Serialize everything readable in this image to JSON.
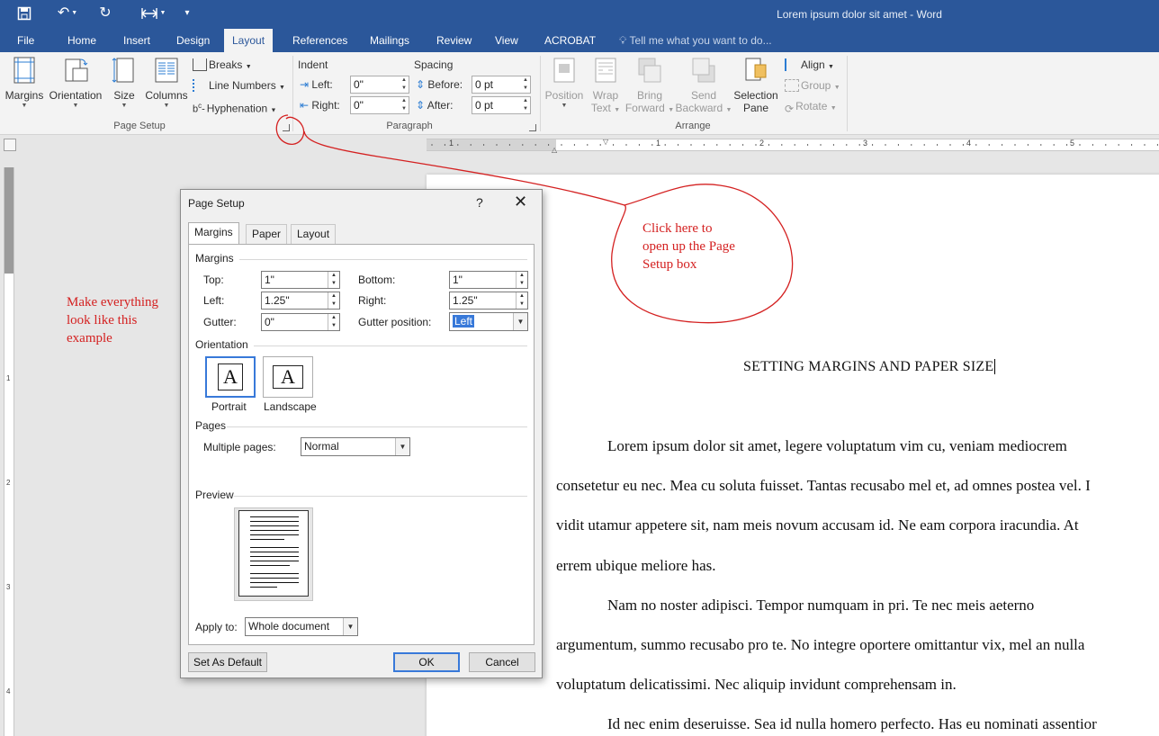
{
  "window": {
    "title": "Lorem ipsum dolor sit amet - Word"
  },
  "tabs": [
    "File",
    "Home",
    "Insert",
    "Design",
    "Layout",
    "References",
    "Mailings",
    "Review",
    "View",
    "ACROBAT"
  ],
  "active_tab": "Layout",
  "tell_me": "Tell me what you want to do...",
  "ribbon": {
    "page_setup": {
      "group_label": "Page Setup",
      "margins": "Margins",
      "orientation": "Orientation",
      "size": "Size",
      "columns": "Columns",
      "breaks": "Breaks",
      "line_numbers": "Line Numbers",
      "hyphenation": "Hyphenation"
    },
    "paragraph": {
      "group_label": "Paragraph",
      "indent_label": "Indent",
      "spacing_label": "Spacing",
      "left_label": "Left:",
      "right_label": "Right:",
      "before_label": "Before:",
      "after_label": "After:",
      "left_value": "0\"",
      "right_value": "0\"",
      "before_value": "0 pt",
      "after_value": "0 pt"
    },
    "arrange": {
      "group_label": "Arrange",
      "position": "Position",
      "wrap_text_1": "Wrap",
      "wrap_text_2": "Text",
      "bring_forward_1": "Bring",
      "bring_forward_2": "Forward",
      "send_backward_1": "Send",
      "send_backward_2": "Backward",
      "selection_pane_1": "Selection",
      "selection_pane_2": "Pane",
      "align": "Align",
      "group": "Group",
      "rotate": "Rotate"
    }
  },
  "ruler": {
    "h_numbers": [
      "1",
      "1",
      "2",
      "3",
      "4",
      "5"
    ],
    "v_numbers": [
      "1",
      "2",
      "3",
      "4"
    ]
  },
  "document": {
    "heading": "SETTING MARGINS AND PAPER SIZE",
    "lines": [
      "Lorem ipsum dolor sit amet, legere voluptatum vim cu, veniam mediocrem",
      "consetetur eu nec. Mea cu soluta fuisset. Tantas recusabo mel et, ad omnes postea vel. I",
      "vidit utamur appetere sit, nam meis novum accusam id. Ne eam corpora iracundia. At",
      "errem ubique meliore has.",
      "Nam no noster adipisci. Tempor numquam in pri. Te nec meis aeterno",
      "argumentum, summo recusabo pro te. No integre oportere omittantur vix, mel an nulla",
      "voluptatum delicatissimi. Nec aliquip invidunt comprehensam in.",
      "Id nec enim deseruisse. Sea id nulla homero perfecto. Has eu nominati assentior"
    ]
  },
  "annotations": {
    "left_note": [
      "Make everything",
      "look like this",
      "example"
    ],
    "right_note": [
      "Click here to",
      "open up the Page",
      "Setup box"
    ],
    "ink_color": "#d42121"
  },
  "dialog": {
    "title": "Page Setup",
    "help": "?",
    "tabs": [
      "Margins",
      "Paper",
      "Layout"
    ],
    "margins_section": "Margins",
    "top_label": "Top:",
    "bottom_label": "Bottom:",
    "left_label": "Left:",
    "right_label": "Right:",
    "gutter_label": "Gutter:",
    "gutter_position_label": "Gutter position:",
    "top_value": "1\"",
    "bottom_value": "1\"",
    "left_value": "1.25\"",
    "right_value": "1.25\"",
    "gutter_value": "0\"",
    "gutter_position_value": "Left",
    "orientation_section": "Orientation",
    "portrait": "Portrait",
    "landscape": "Landscape",
    "orientation_glyph": "A",
    "pages_section": "Pages",
    "multiple_pages_label": "Multiple pages:",
    "multiple_pages_value": "Normal",
    "preview_section": "Preview",
    "apply_to_label": "Apply to:",
    "apply_to_value": "Whole document",
    "set_default": "Set As Default",
    "ok": "OK",
    "cancel": "Cancel"
  },
  "colors": {
    "title_bar": "#2b579a",
    "accent": "#3879d9"
  }
}
